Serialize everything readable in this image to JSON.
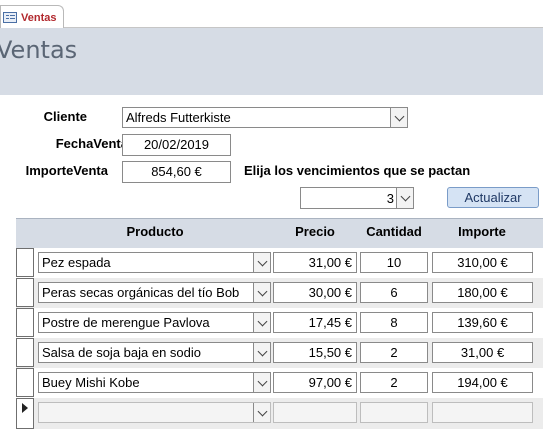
{
  "tab": {
    "label": "Ventas"
  },
  "header": {
    "title": "Ventas"
  },
  "form": {
    "cliente_label": "Cliente",
    "cliente_value": "Alfreds Futterkiste",
    "fecha_label": "FechaVenta",
    "fecha_value": "20/02/2019",
    "importe_label": "ImporteVenta",
    "importe_value": "854,60 €",
    "vencimientos_label": "Elija los vencimientos que se pactan",
    "vencimientos_value": "3",
    "update_button": "Actualizar"
  },
  "table": {
    "columns": [
      "Producto",
      "Precio",
      "Cantidad",
      "Importe"
    ],
    "rows": [
      {
        "producto": "Pez espada",
        "precio": "31,00 €",
        "cantidad": "10",
        "importe": "310,00 €"
      },
      {
        "producto": "Peras secas orgánicas del tío Bob",
        "precio": "30,00 €",
        "cantidad": "6",
        "importe": "180,00 €"
      },
      {
        "producto": "Postre de merengue Pavlova",
        "precio": "17,45 €",
        "cantidad": "8",
        "importe": "139,60 €"
      },
      {
        "producto": "Salsa de soja baja en sodio",
        "precio": "15,50 €",
        "cantidad": "2",
        "importe": "31,00 €"
      },
      {
        "producto": "Buey Mishi Kobe",
        "precio": "97,00 €",
        "cantidad": "2",
        "importe": "194,00 €"
      }
    ]
  },
  "icons": {
    "tab_icon": "form-icon",
    "dropdown": "chevron-down-icon",
    "new_record": "new-record-arrow-icon"
  },
  "colors": {
    "header_bg": "#d6dce5",
    "tab_text": "#b2292e",
    "button_bg": "#d5e3f4"
  }
}
